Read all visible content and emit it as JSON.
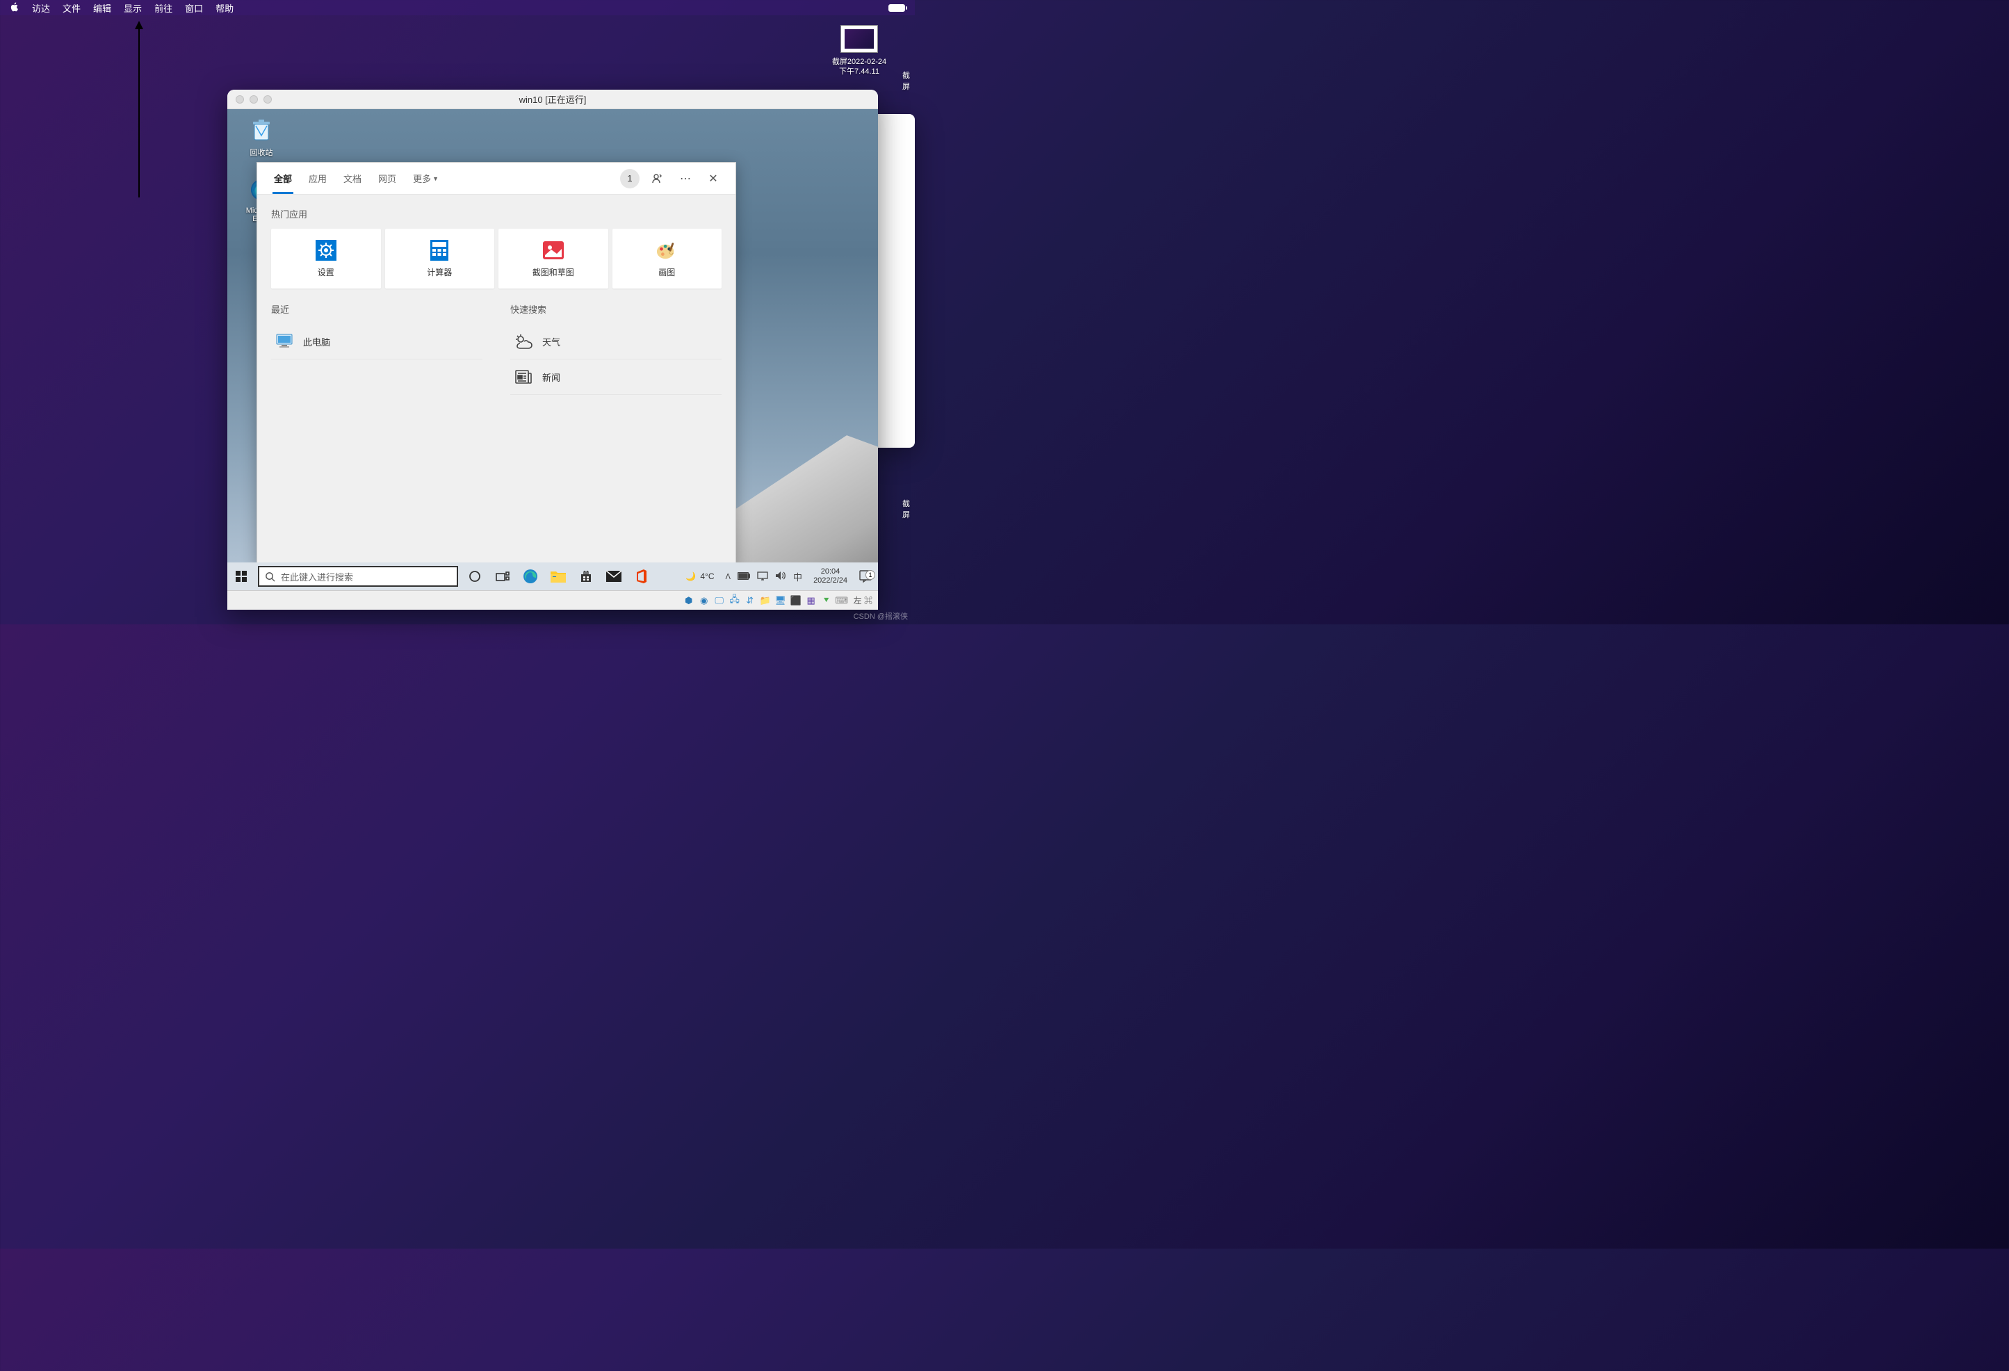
{
  "mac_menu": {
    "items": [
      "访达",
      "文件",
      "编辑",
      "显示",
      "前往",
      "窗口",
      "帮助"
    ]
  },
  "desktop": {
    "icon1_label": "截屏2022-02-24\n下午7.44.11",
    "partial_labels": [
      "截屏",
      "截屏",
      "截屏",
      "截屏",
      "截屏",
      "截屏"
    ]
  },
  "vm": {
    "title": "win10 [正在运行]",
    "status_text": "左 ⌘"
  },
  "win_desktop": {
    "recycle_label": "回收站",
    "edge_label": "Microsoft\nEdge"
  },
  "search": {
    "tabs": {
      "all": "全部",
      "apps": "应用",
      "docs": "文档",
      "web": "网页",
      "more": "更多"
    },
    "badge_count": "1",
    "top_apps_label": "热门应用",
    "apps": [
      {
        "name": "设置"
      },
      {
        "name": "计算器"
      },
      {
        "name": "截图和草图"
      },
      {
        "name": "画图"
      }
    ],
    "recent_label": "最近",
    "recent_items": [
      {
        "name": "此电脑"
      }
    ],
    "quick_label": "快速搜索",
    "quick_items": [
      {
        "name": "天气"
      },
      {
        "name": "新闻"
      }
    ]
  },
  "taskbar": {
    "search_placeholder": "在此键入进行搜索",
    "weather_temp": "4°C",
    "ime": "中",
    "clock_time": "20:04",
    "clock_date": "2022/2/24",
    "notif_count": "1"
  },
  "watermark": "CSDN @摇滚侠"
}
